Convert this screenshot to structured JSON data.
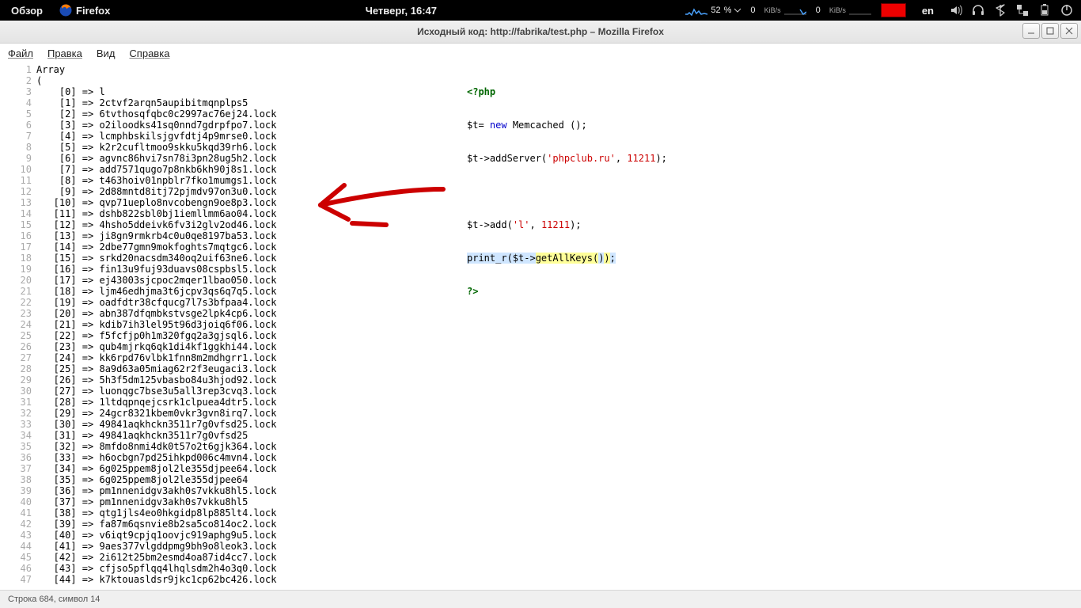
{
  "panel": {
    "overview": "Обзор",
    "firefox": "Firefox",
    "clock": "Четверг, 16:47",
    "battery_pct": "52",
    "battery_sym": "%",
    "net1_val": "0",
    "net1_unit": "KiB/s",
    "net2_val": "0",
    "net2_unit": "KiB/s",
    "lang": "en"
  },
  "window": {
    "title": "Исходный код: http://fabrika/test.php – Mozilla Firefox"
  },
  "menu": {
    "file": "Файл",
    "edit": "Правка",
    "view": "Вид",
    "help": "Справка"
  },
  "source": {
    "start_line": 1,
    "lines": [
      "Array",
      "(",
      "    [0] => l",
      "    [1] => 2ctvf2arqn5aupibitmqnplps5",
      "    [2] => 6tvthosqfqbc0c2997ac76ej24.lock",
      "    [3] => o2iloodks41sq0nnd7gdrpfpo7.lock",
      "    [4] => lcmphbskilsjgvfdtj4p9mrse0.lock",
      "    [5] => k2r2cufltmoo9skku5kqd39rh6.lock",
      "    [6] => agvnc86hvi7sn78i3pn28ug5h2.lock",
      "    [7] => add7571qugo7p8nkb6kh90j8s1.lock",
      "    [8] => t463hoiv01npblr7fko1mumgs1.lock",
      "    [9] => 2d88mntd8itj72pjmdv97on3u0.lock",
      "   [10] => qvp71ueplo8nvcobengn9oe8p3.lock",
      "   [11] => dshb822sbl0bj1iemllmm6ao04.lock",
      "   [12] => 4hsho5ddeivk6fv3i2glv2od46.lock",
      "   [13] => ji8gn9rmkrb4c0u0qe8197ba53.lock",
      "   [14] => 2dbe77gmn9mokfoghts7mqtgc6.lock",
      "   [15] => srkd20nacsdm340oq2uif63ne6.lock",
      "   [16] => fin13u9fuj93duavs08cspbsl5.lock",
      "   [17] => ej43003sjcpoc2mqer1lbao050.lock",
      "   [18] => ljm46edhjma3t6jcpv3qs6q7q5.lock",
      "   [19] => oadfdtr38cfqucg7l7s3bfpaa4.lock",
      "   [20] => abn387dfqmbkstvsge2lpk4cp6.lock",
      "   [21] => kdib7ih3lel95t96d3joiq6f06.lock",
      "   [22] => f5fcfjp0h1m320fgq2a3gjsql6.lock",
      "   [23] => qub4mjrkq6qk1di4kf1ggkhi44.lock",
      "   [24] => kk6rpd76vlbk1fnn8m2mdhgrr1.lock",
      "   [25] => 8a9d63a05miag62r2f3eugaci3.lock",
      "   [26] => 5h3f5dm125vbasbo84u3hjod92.lock",
      "   [27] => luonqgc7bse3u5all3rep3cvq3.lock",
      "   [28] => 1ltdqpnqejcsrk1clpuea4dtr5.lock",
      "   [29] => 24gcr8321kbem0vkr3gvn8irq7.lock",
      "   [30] => 49841aqkhckn3511r7g0vfsd25.lock",
      "   [31] => 49841aqkhckn3511r7g0vfsd25",
      "   [32] => 8mfdo8nmi4dk0t57o2t6gjk364.lock",
      "   [33] => h6ocbgn7pd25ihkpd006c4mvn4.lock",
      "   [34] => 6g025ppem8jol2le355djpee64.lock",
      "   [35] => 6g025ppem8jol2le355djpee64",
      "   [36] => pm1nnenidgv3akh0s7vkku8hl5.lock",
      "   [37] => pm1nnenidgv3akh0s7vkku8hl5",
      "   [38] => qtg1jls4eo0hkgidp8lp885lt4.lock",
      "   [39] => fa87m6qsnvie8b2sa5co814oc2.lock",
      "   [40] => v6iqt9cpjq1oovjc919aphg9u5.lock",
      "   [41] => 9aes377vlgddpmg9bh9o8leok3.lock",
      "   [42] => 2i612t25bm2esmd4oa87id4cc7.lock",
      "   [43] => cfjso5pflqq4lhqlsdm2h4o3q0.lock",
      "   [44] => k7ktouasldsr9jkc1cp62bc426.lock"
    ]
  },
  "code": {
    "server_str": "'phpclub.ru'",
    "server_port": "11211",
    "add_key": "'l'",
    "add_val": "11211"
  },
  "status": {
    "text": "Строка 684, символ 14"
  }
}
